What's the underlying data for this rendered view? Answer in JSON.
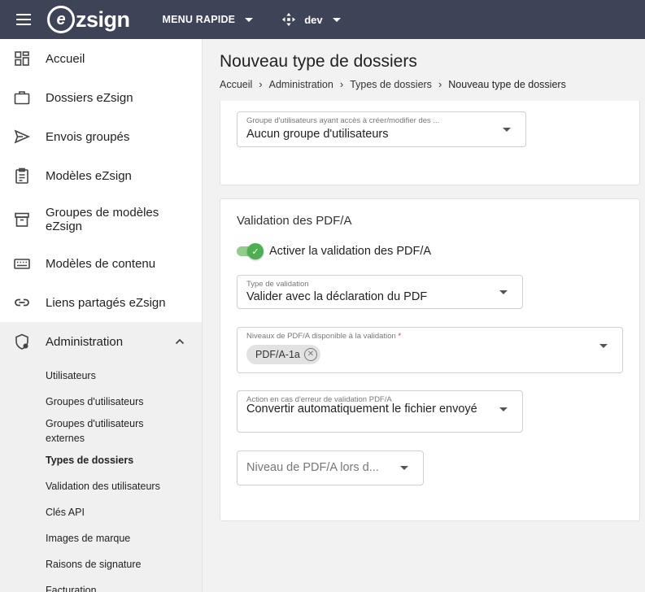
{
  "topbar": {
    "logo_letter": "e",
    "logo_text": "zsign",
    "menu_label": "MENU RAPIDE",
    "env_label": "dev"
  },
  "sidebar": {
    "items": [
      {
        "label": "Accueil",
        "icon": "dashboard-icon"
      },
      {
        "label": "Dossiers eZsign",
        "icon": "briefcase-icon"
      },
      {
        "label": "Envois groupés",
        "icon": "send-icon"
      },
      {
        "label": "Modèles eZsign",
        "icon": "clipboard-icon"
      },
      {
        "label": "Groupes de modèles eZsign",
        "icon": "archive-icon"
      },
      {
        "label": "Modèles de contenu",
        "icon": "keyboard-icon"
      },
      {
        "label": "Liens partagés eZsign",
        "icon": "link-icon"
      }
    ],
    "admin": {
      "label": "Administration",
      "icon": "shield-lock-icon",
      "subitems": [
        "Utilisateurs",
        "Groupes d'utilisateurs",
        "Groupes d'utilisateurs externes",
        "Types de dossiers",
        "Validation des utilisateurs",
        "Clés API",
        "Images de marque",
        "Raisons de signature",
        "Facturation"
      ],
      "active_index": 3
    }
  },
  "page": {
    "title": "Nouveau type de dossiers",
    "breadcrumb": [
      "Accueil",
      "Administration",
      "Types de dossiers",
      "Nouveau type de dossiers"
    ]
  },
  "card1": {
    "group_field": {
      "label": "Groupe d'utilisateurs ayant accès à créer/modifier des ...",
      "value": "Aucun groupe d'utilisateurs"
    }
  },
  "card2": {
    "title": "Validation des PDF/A",
    "toggle_label": "Activer la validation des PDF/A",
    "toggle_on": true,
    "validation_type": {
      "label": "Type de validation",
      "value": "Valider avec la déclaration du PDF"
    },
    "levels": {
      "label": "Niveaux de PDF/A disponible à la validation",
      "required_mark": "*",
      "chips": [
        "PDF/A-1a"
      ]
    },
    "error_action": {
      "label": "Action en cas d'erreur de validation PDF/A",
      "value": "Convertir automatiquement le fichier envoyé"
    },
    "level_on_convert": {
      "placeholder": "Niveau de PDF/A lors d..."
    }
  },
  "colors": {
    "topbar": "#3e4457",
    "toggle_on": "#4caf50",
    "required": "#dd3333"
  }
}
